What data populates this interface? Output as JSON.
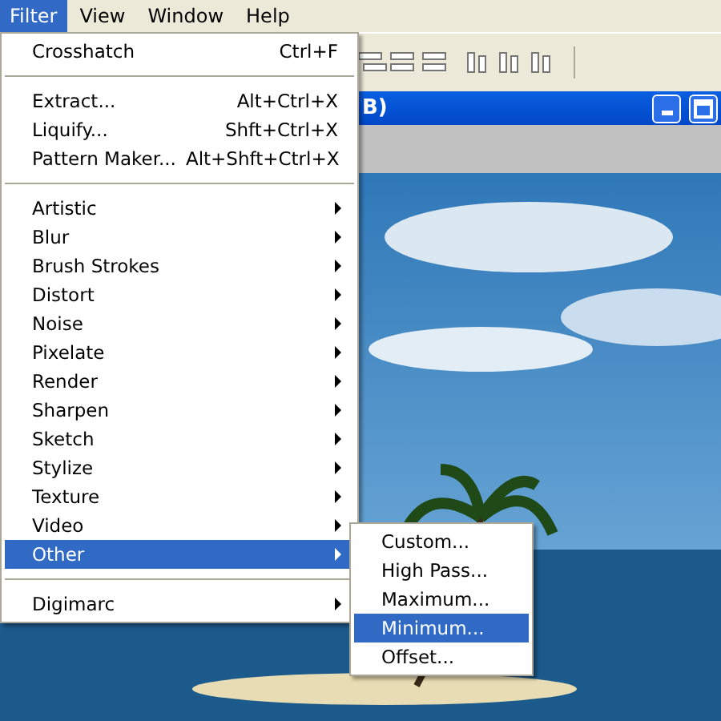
{
  "menu_bar": [
    {
      "label": "Filter",
      "selected": true
    },
    {
      "label": "View",
      "selected": false
    },
    {
      "label": "Window",
      "selected": false
    },
    {
      "label": "Help",
      "selected": false
    }
  ],
  "document_window": {
    "title": "B)"
  },
  "filter_menu": {
    "items": [
      {
        "kind": "item",
        "label": "Crosshatch",
        "shortcut": "Ctrl+F",
        "selected": false
      },
      {
        "kind": "separator"
      },
      {
        "kind": "item",
        "label": "Extract...",
        "shortcut": "Alt+Ctrl+X",
        "selected": false
      },
      {
        "kind": "item",
        "label": "Liquify...",
        "shortcut": "Shft+Ctrl+X",
        "selected": false
      },
      {
        "kind": "item",
        "label": "Pattern Maker...",
        "shortcut": "Alt+Shft+Ctrl+X",
        "selected": false
      },
      {
        "kind": "separator"
      },
      {
        "kind": "submenu",
        "label": "Artistic",
        "selected": false
      },
      {
        "kind": "submenu",
        "label": "Blur",
        "selected": false
      },
      {
        "kind": "submenu",
        "label": "Brush Strokes",
        "selected": false
      },
      {
        "kind": "submenu",
        "label": "Distort",
        "selected": false
      },
      {
        "kind": "submenu",
        "label": "Noise",
        "selected": false
      },
      {
        "kind": "submenu",
        "label": "Pixelate",
        "selected": false
      },
      {
        "kind": "submenu",
        "label": "Render",
        "selected": false
      },
      {
        "kind": "submenu",
        "label": "Sharpen",
        "selected": false
      },
      {
        "kind": "submenu",
        "label": "Sketch",
        "selected": false
      },
      {
        "kind": "submenu",
        "label": "Stylize",
        "selected": false
      },
      {
        "kind": "submenu",
        "label": "Texture",
        "selected": false
      },
      {
        "kind": "submenu",
        "label": "Video",
        "selected": false
      },
      {
        "kind": "submenu",
        "label": "Other",
        "selected": true
      },
      {
        "kind": "separator"
      },
      {
        "kind": "submenu",
        "label": "Digimarc",
        "selected": false
      }
    ]
  },
  "other_submenu": {
    "items": [
      {
        "label": "Custom...",
        "selected": false
      },
      {
        "label": "High Pass...",
        "selected": false
      },
      {
        "label": "Maximum...",
        "selected": false
      },
      {
        "label": "Minimum...",
        "selected": true
      },
      {
        "label": "Offset...",
        "selected": false
      }
    ]
  }
}
